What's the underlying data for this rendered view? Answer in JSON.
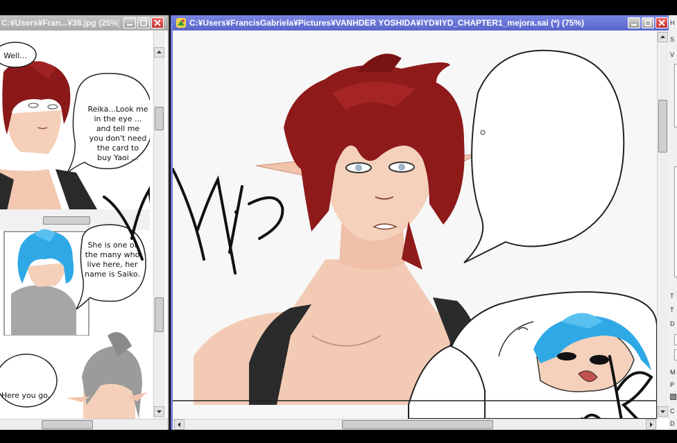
{
  "left_window": {
    "title": "C:¥Users¥Fran...¥38.jpg (25%)",
    "bubbles": {
      "well": "Well...",
      "reika": [
        "Reika...Look me",
        "in the eye ...",
        "and tell me",
        "you don't need",
        "the card to",
        "buy Yaoi ..."
      ],
      "saiko": [
        "She is one of",
        "the many who",
        "live here, her",
        "name is Saiko."
      ],
      "here": "Here you go."
    }
  },
  "main_window": {
    "title": "C:¥Users¥FrancisGabriela¥Pictures¥VANHDER YOSHIDA¥IYD¥IYD_CHAPTER1_mejora.sai (*) (75%)"
  },
  "right_panel": {
    "chars": [
      "H",
      "S",
      "V",
      "T",
      "T",
      "D",
      "M",
      "P",
      "C",
      "D"
    ]
  },
  "colors": {
    "active_title": "#5f6bd0",
    "inactive_title": "#b0b0b0",
    "hair_red": "#8e1a1a",
    "hair_blue": "#2fa9e6",
    "skin": "#f4cbb4"
  },
  "icons": [
    "minimize-icon",
    "maximize-icon",
    "close-icon",
    "app-icon",
    "scroll-up-icon",
    "scroll-down-icon",
    "scroll-left-icon",
    "scroll-right-icon"
  ]
}
